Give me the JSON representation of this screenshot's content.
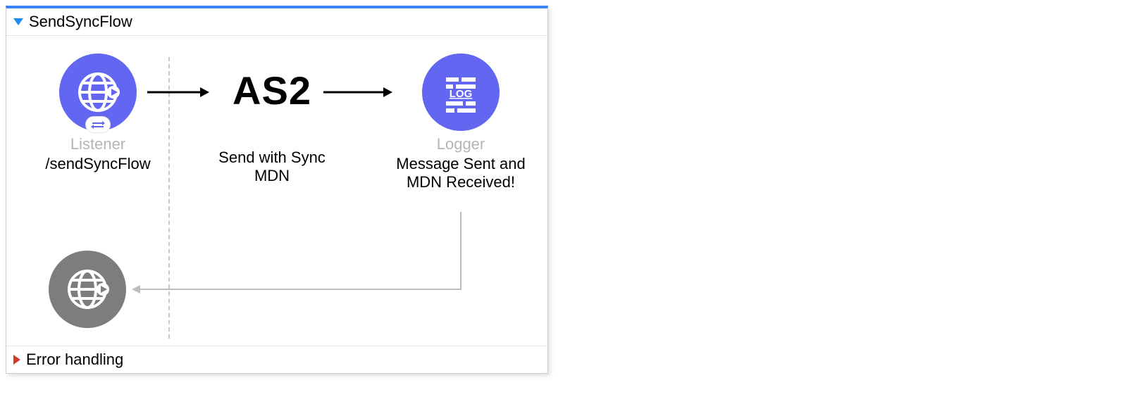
{
  "flow": {
    "title": "SendSyncFlow",
    "error_section_title": "Error handling",
    "nodes": {
      "listener": {
        "type_label": "Listener",
        "detail": "/sendSyncFlow"
      },
      "as2": {
        "icon_text": "AS2",
        "detail": "Send with Sync MDN"
      },
      "logger": {
        "type_label": "Logger",
        "detail": "Message Sent and MDN Received!"
      }
    }
  }
}
